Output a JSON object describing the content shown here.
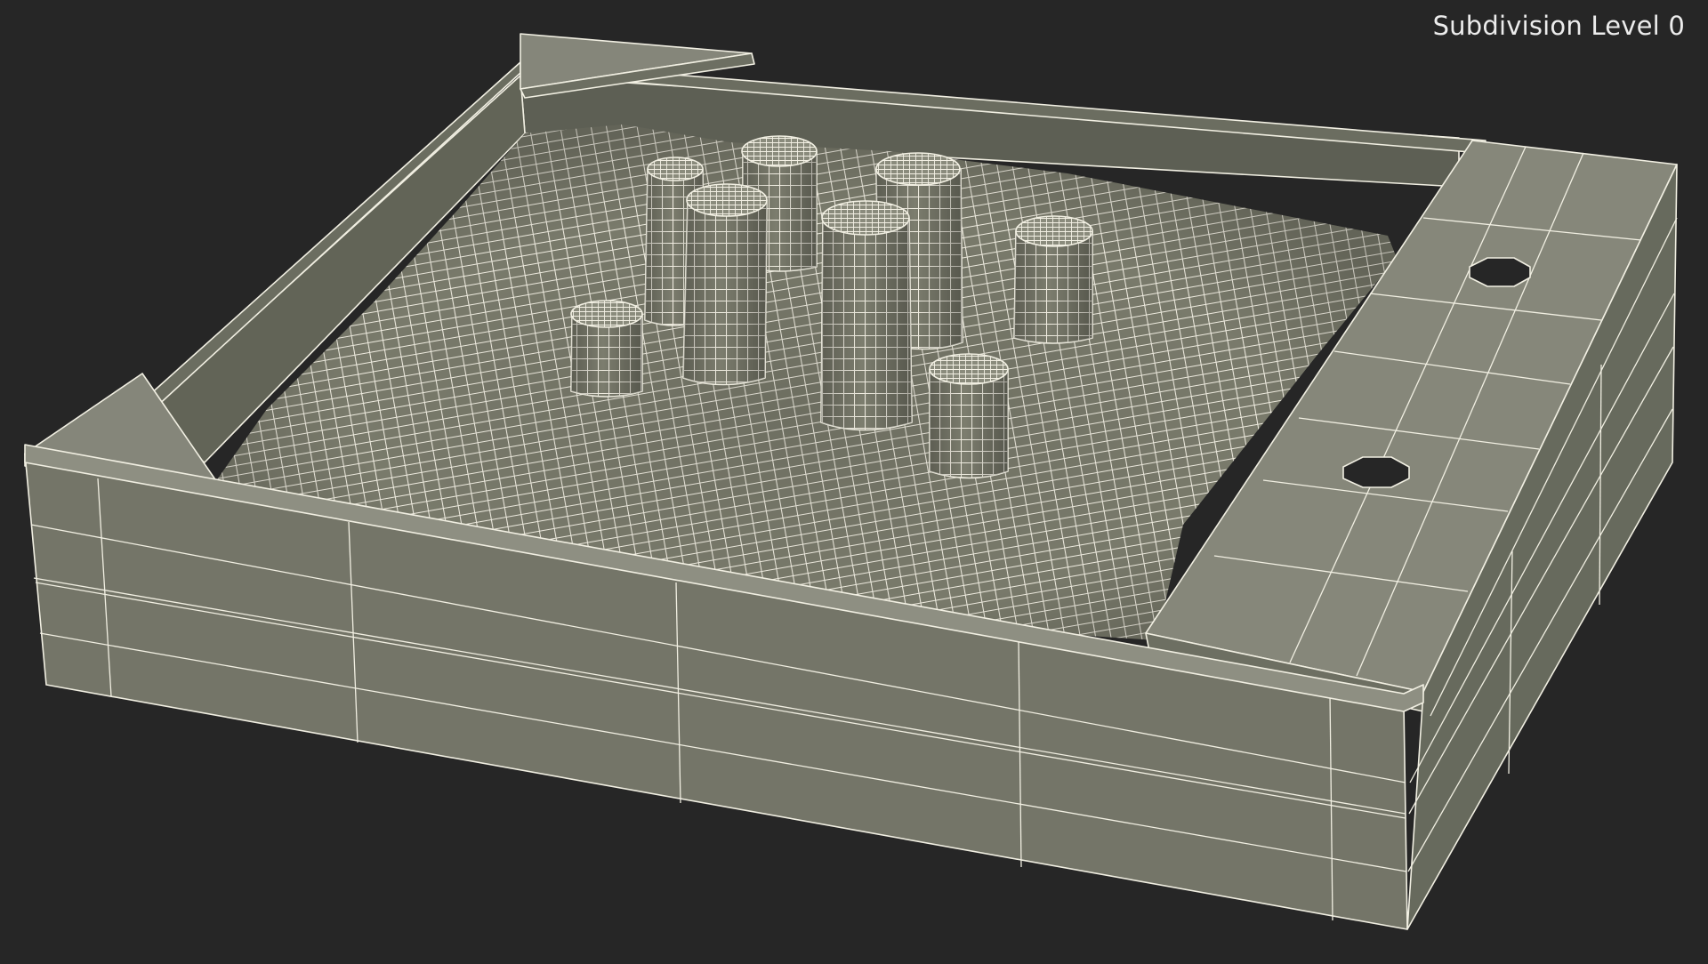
{
  "viewport": {
    "subdivision_label": "Subdivision Level 0",
    "background_color": "#262626",
    "model_face_color": "#7a7b6c",
    "model_shade_color": "#5e6054",
    "wire_color": "#f1efe2"
  },
  "scene": {
    "object": "sandbox-model",
    "display_mode": "wireframe-on-shaded"
  }
}
